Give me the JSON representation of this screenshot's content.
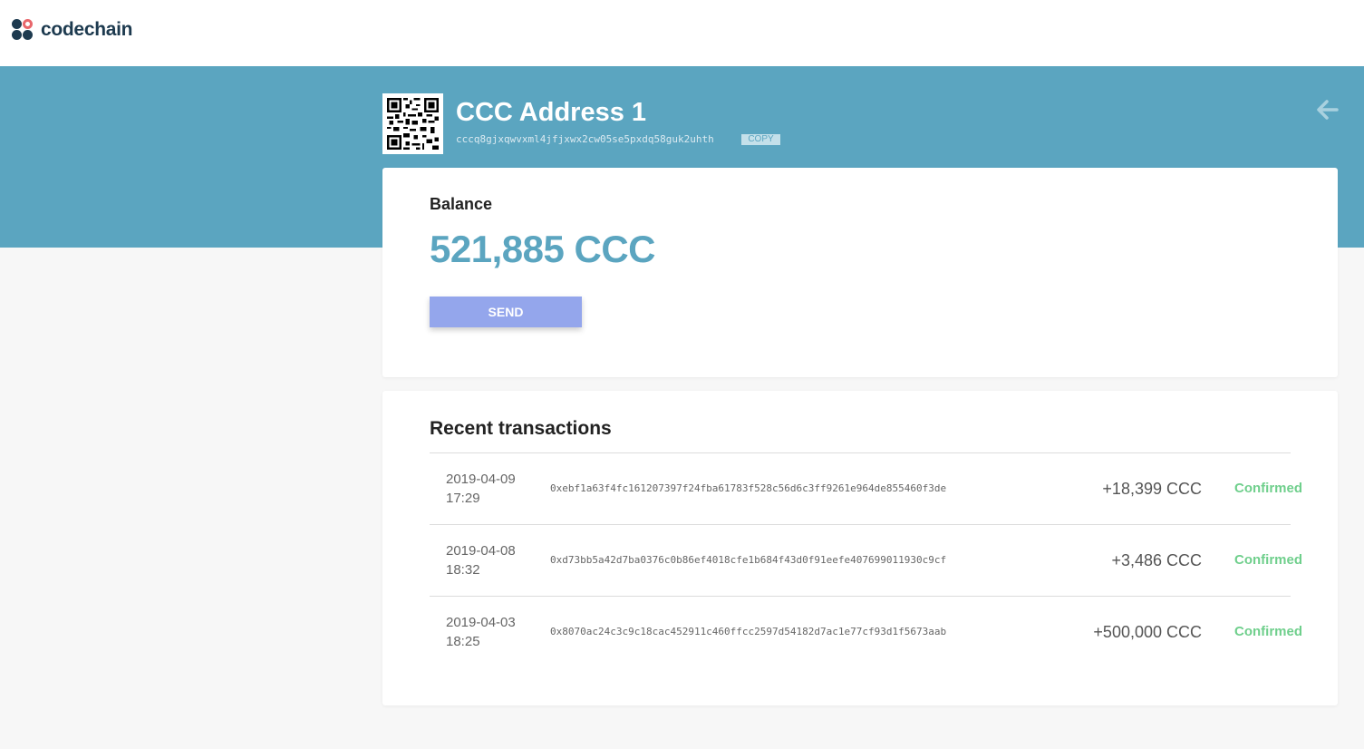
{
  "app": {
    "logo_text": "codechain"
  },
  "address": {
    "title": "CCC Address 1",
    "hash": "cccq8gjxqwvxml4jfjxwx2cw05se5pxdq58guk2uhth",
    "copy_label": "COPY"
  },
  "icons": {
    "back": "arrow-left-icon",
    "qr": "qr-code-icon",
    "logo": "codechain-logo-icon"
  },
  "balance": {
    "label": "Balance",
    "value": "521,885 CCC",
    "send_label": "SEND"
  },
  "transactions": {
    "title": "Recent transactions",
    "rows": [
      {
        "date": "2019-04-09",
        "time": "17:29",
        "hash": "0xebf1a63f4fc161207397f24fba61783f528c56d6c3ff9261e964de855460f3de",
        "amount": "+18,399 CCC",
        "status": "Confirmed"
      },
      {
        "date": "2019-04-08",
        "time": "18:32",
        "hash": "0xd73bb5a42d7ba0376c0b86ef4018cfe1b684f43d0f91eefe407699011930c9cf",
        "amount": "+3,486 CCC",
        "status": "Confirmed"
      },
      {
        "date": "2019-04-03",
        "time": "18:25",
        "hash": "0x8070ac24c3c9c18cac452911c460ffcc2597d54182d7ac1e77cf93d1f5673aab",
        "amount": "+500,000 CCC",
        "status": "Confirmed"
      }
    ]
  },
  "colors": {
    "accent": "#5ba5c0",
    "send_button": "#94a6ec",
    "status_confirmed": "#6fcf8c",
    "logo_dark": "#1d3a4f",
    "logo_accent": "#e8666b"
  }
}
